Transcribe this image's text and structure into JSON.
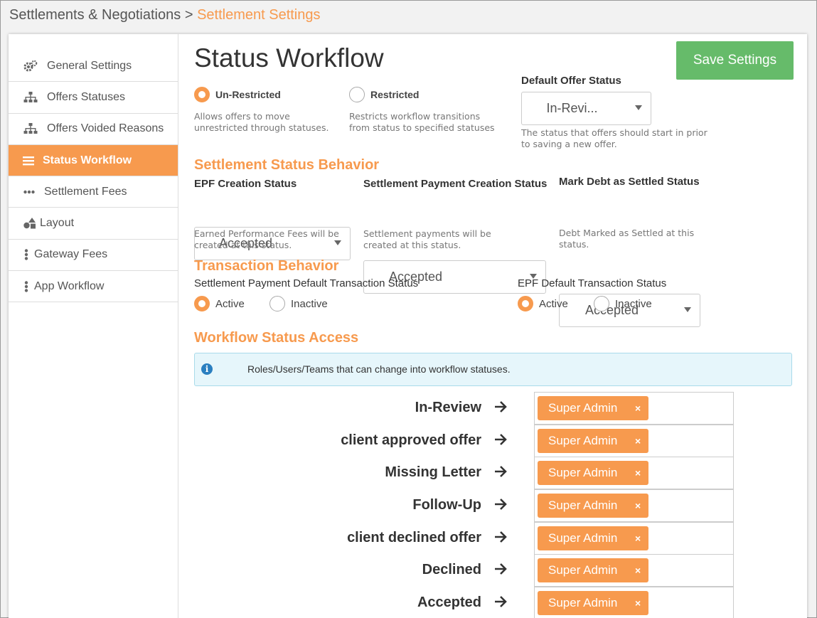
{
  "breadcrumb": {
    "parent": "Settlements & Negotiations",
    "separator": ">",
    "current": "Settlement Settings"
  },
  "sidebar": {
    "items": [
      {
        "label": "General Settings",
        "icon": "gears-icon"
      },
      {
        "label": "Offers Statuses",
        "icon": "sitemap-icon"
      },
      {
        "label": "Offers Voided Reasons",
        "icon": "sitemap-icon"
      },
      {
        "label": "Status Workflow",
        "icon": "list-icon",
        "active": true
      },
      {
        "label": "Settlement Fees",
        "icon": "ellipsis-horizontal-icon"
      },
      {
        "label": "Layout",
        "icon": "shapes-icon"
      },
      {
        "label": "Gateway Fees",
        "icon": "ellipsis-vertical-icon"
      },
      {
        "label": "App Workflow",
        "icon": "ellipsis-vertical-icon"
      }
    ]
  },
  "main": {
    "title": "Status Workflow",
    "save_label": "Save Settings",
    "mode": {
      "unrestricted_label": "Un-Restricted",
      "unrestricted_help": "Allows offers to move unrestricted through statuses.",
      "restricted_label": "Restricted",
      "restricted_help": "Restricts workflow transitions from status to specified statuses",
      "selected": "Un-Restricted"
    },
    "default_offer": {
      "label": "Default Offer Status",
      "value": "In-Revi...",
      "help": "The status that offers should start in prior to saving a new offer."
    },
    "settlement_behavior": {
      "title": "Settlement Status Behavior",
      "epf": {
        "label": "EPF Creation Status",
        "value": "Accepted",
        "help": "Earned Performance Fees will be created at this status."
      },
      "payment": {
        "label": "Settlement Payment Creation Status",
        "value": "Accepted",
        "help": "Settlement payments will be created at this status."
      },
      "settled": {
        "label": "Mark Debt as Settled Status",
        "value": "Accepted",
        "help": "Debt Marked as Settled at this status."
      }
    },
    "transaction_behavior": {
      "title": "Transaction Behavior",
      "payment_default": {
        "label": "Settlement Payment Default Transaction Status",
        "active": "Active",
        "inactive": "Inactive",
        "selected": "Active"
      },
      "epf_default": {
        "label": "EPF Default Transaction Status",
        "active": "Active",
        "inactive": "Inactive",
        "selected": "Active"
      }
    },
    "access": {
      "title": "Workflow Status Access",
      "info": "Roles/Users/Teams that can change into workflow statuses.",
      "rows": [
        {
          "status": "In-Review",
          "tag": "Super Admin",
          "remove": "×"
        },
        {
          "status": "client approved offer",
          "tag": "Super Admin",
          "remove": "×"
        },
        {
          "status": "Missing Letter",
          "tag": "Super Admin",
          "remove": "×"
        },
        {
          "status": "Follow-Up",
          "tag": "Super Admin",
          "remove": "×"
        },
        {
          "status": "client declined offer",
          "tag": "Super Admin",
          "remove": "×"
        },
        {
          "status": "Declined",
          "tag": "Super Admin",
          "remove": "×"
        },
        {
          "status": "Accepted",
          "tag": "Super Admin",
          "remove": "×"
        }
      ]
    }
  },
  "colors": {
    "accent": "#f79a4e",
    "save": "#66bb6a",
    "info_bg": "#e6f6fb"
  }
}
